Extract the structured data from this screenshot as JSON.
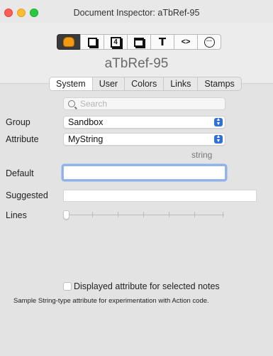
{
  "window": {
    "title": "Document Inspector: aTbRef-95"
  },
  "toolbar": {
    "buttons": [
      {
        "name": "general-icon",
        "label": ""
      },
      {
        "name": "text-icon",
        "label": ""
      },
      {
        "name": "quickstamp-icon",
        "label": "4"
      },
      {
        "name": "appearance-icon",
        "label": ""
      },
      {
        "name": "text-format-icon",
        "label": "T"
      },
      {
        "name": "action-icon",
        "label": "<>"
      },
      {
        "name": "more-icon",
        "label": "···"
      }
    ]
  },
  "note_name": "aTbRef-95",
  "tabs": {
    "items": [
      "System",
      "User",
      "Colors",
      "Links",
      "Stamps"
    ],
    "active": "System"
  },
  "search": {
    "placeholder": "Search"
  },
  "group": {
    "label": "Group",
    "value": "Sandbox"
  },
  "attribute": {
    "label": "Attribute",
    "value": "MyString",
    "type": "string"
  },
  "default": {
    "label": "Default",
    "value": ""
  },
  "suggested": {
    "label": "Suggested",
    "value": ""
  },
  "lines": {
    "label": "Lines"
  },
  "displayed": {
    "label": "Displayed attribute for selected notes",
    "checked": false
  },
  "description": "Sample String-type attribute for experimentation with Action code."
}
